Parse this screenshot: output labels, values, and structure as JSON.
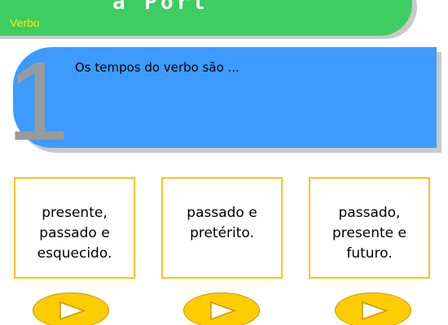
{
  "header": {
    "title": "a Port",
    "subtitle": "Verbo"
  },
  "question": {
    "number": "1",
    "text": "Os tempos do verbo são ..."
  },
  "answers": [
    {
      "text": "presente,\npassado e\nesquecido."
    },
    {
      "text": "passado e\npretérito."
    },
    {
      "text": "passado,\npresente e\nfuturo."
    }
  ],
  "icons": {
    "play": "play-icon"
  },
  "colors": {
    "header": "#3dcd61",
    "subtitle": "#ffea00",
    "question_panel": "#3d9bff",
    "answer_border": "#fcc418",
    "play_button": "#ffcc00"
  }
}
